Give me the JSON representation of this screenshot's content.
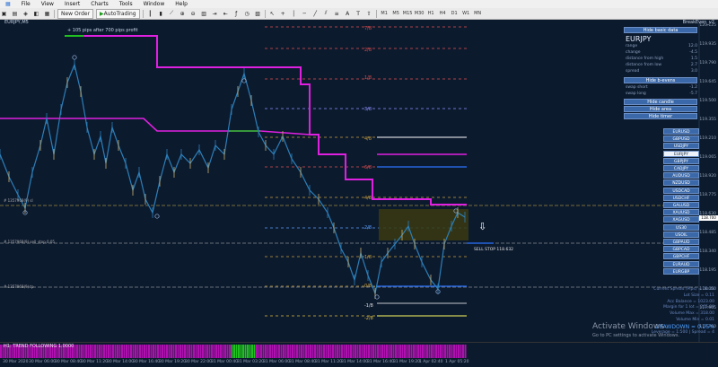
{
  "menu": [
    "File",
    "View",
    "Insert",
    "Charts",
    "Tools",
    "Window",
    "Help"
  ],
  "toolbar": {
    "new_order": "New Order",
    "autotrading": "AutoTrading",
    "timeframes": [
      "M1",
      "M5",
      "M15",
      "M30",
      "H1",
      "H4",
      "D1",
      "W1",
      "MN"
    ]
  },
  "chart": {
    "symbol_title": "EURJPY,M5",
    "profit_note": "+ 105 pips after 700 pips profit",
    "ea_name": "BreakEven_v2",
    "sell_stop": "SELL STOP 118.632",
    "left_levels": [
      "# 1357968(9) sl",
      "# 1357968(9) sell_stop 0.05",
      "# 1357968(9) tp"
    ],
    "grid_labels": [
      "7/8",
      "2/8",
      "1/8",
      "3/8",
      "4/8",
      "6/8",
      "4/8",
      "2/8",
      "1/8",
      "0/8",
      "-1/8",
      "-2/8"
    ],
    "price_scale": [
      "120.125",
      "119.935",
      "119.790",
      "119.645",
      "119.500",
      "119.355",
      "119.210",
      "119.065",
      "118.920",
      "118.775",
      "118.630",
      "118.485",
      "118.340",
      "118.195",
      "118.050",
      "117.905",
      "117.760"
    ],
    "current_price": "118.700",
    "colors": {
      "magenta": "#e020e0",
      "green": "#20c020",
      "blue": "#2b74ff",
      "candles": "#2c7fb8"
    }
  },
  "panel": {
    "hide_basic_data": "Hide basic data",
    "symbol": "EURJPY",
    "rows": [
      {
        "label": "range",
        "value": "12.0"
      },
      {
        "label": "change",
        "value": "-4.5"
      },
      {
        "label": "distance from high",
        "value": "1.5"
      },
      {
        "label": "distance from low",
        "value": "2.7"
      },
      {
        "label": "spread",
        "value": "3.0"
      }
    ],
    "hide_breakeven": "Hide b-evens",
    "swaps": [
      {
        "label": "swap short",
        "value": "-1.2"
      },
      {
        "label": "swap long",
        "value": "-5.7"
      }
    ],
    "hide_candle": "Hide candle",
    "hide_area": "Hide area",
    "hide_timer": "Hide timer",
    "pairs": [
      "EURUSD",
      "GBPUSD",
      "USDJPY",
      "EURJPY",
      "GBPJPY",
      "CADJPY",
      "AUDUSD",
      "NZDUSD",
      "USDCAD",
      "USDCHF",
      "GALUSD",
      "XAUUSD",
      "XAGUSD",
      "US30",
      "USOIL",
      "GBPAUD",
      "GBPCAD",
      "GBPCHF",
      "EURAUD",
      "EURGBP"
    ],
    "active_pair": "EURJPY"
  },
  "stats": [
    "Current Spread (Pips) = 00.30",
    "Lot Size = 0.11",
    "Acc Balance = 1023.00",
    "Margin for 1 lot = 265.00",
    "Volume Max = 318.00",
    "Volume Min = 0.01",
    "DRAWDOWN = 0.25%",
    "Leverage = 1:500 | Spread = 4"
  ],
  "indicator": {
    "label": "H1: TREND FOLLOWING 1.0000"
  },
  "time_axis": [
    "30 Mar 2020",
    "30 Mar 06:00",
    "30 Mar 08:40",
    "30 Mar 11:20",
    "30 Mar 14:00",
    "30 Mar 16:40",
    "30 Mar 19:20",
    "30 Mar 22:00",
    "31 Mar 00:40",
    "31 Mar 03:20",
    "31 Mar 06:00",
    "31 Mar 08:40",
    "31 Mar 11:20",
    "31 Mar 14:00",
    "31 Mar 16:40",
    "31 Mar 19:20",
    "1 Apr 02:40",
    "1 Apr 05:20"
  ],
  "watermark": {
    "title": "Activate Windows",
    "sub": "Go to PC settings to activate Windows."
  }
}
